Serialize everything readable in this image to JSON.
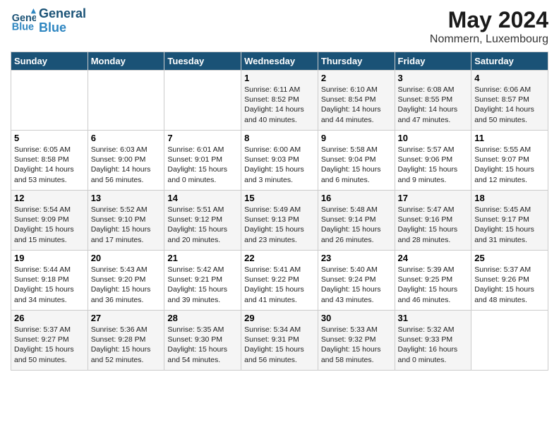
{
  "header": {
    "logo_general": "General",
    "logo_blue": "Blue",
    "month": "May 2024",
    "location": "Nommern, Luxembourg"
  },
  "weekdays": [
    "Sunday",
    "Monday",
    "Tuesday",
    "Wednesday",
    "Thursday",
    "Friday",
    "Saturday"
  ],
  "weeks": [
    [
      {
        "day": "",
        "info": ""
      },
      {
        "day": "",
        "info": ""
      },
      {
        "day": "",
        "info": ""
      },
      {
        "day": "1",
        "info": "Sunrise: 6:11 AM\nSunset: 8:52 PM\nDaylight: 14 hours\nand 40 minutes."
      },
      {
        "day": "2",
        "info": "Sunrise: 6:10 AM\nSunset: 8:54 PM\nDaylight: 14 hours\nand 44 minutes."
      },
      {
        "day": "3",
        "info": "Sunrise: 6:08 AM\nSunset: 8:55 PM\nDaylight: 14 hours\nand 47 minutes."
      },
      {
        "day": "4",
        "info": "Sunrise: 6:06 AM\nSunset: 8:57 PM\nDaylight: 14 hours\nand 50 minutes."
      }
    ],
    [
      {
        "day": "5",
        "info": "Sunrise: 6:05 AM\nSunset: 8:58 PM\nDaylight: 14 hours\nand 53 minutes."
      },
      {
        "day": "6",
        "info": "Sunrise: 6:03 AM\nSunset: 9:00 PM\nDaylight: 14 hours\nand 56 minutes."
      },
      {
        "day": "7",
        "info": "Sunrise: 6:01 AM\nSunset: 9:01 PM\nDaylight: 15 hours\nand 0 minutes."
      },
      {
        "day": "8",
        "info": "Sunrise: 6:00 AM\nSunset: 9:03 PM\nDaylight: 15 hours\nand 3 minutes."
      },
      {
        "day": "9",
        "info": "Sunrise: 5:58 AM\nSunset: 9:04 PM\nDaylight: 15 hours\nand 6 minutes."
      },
      {
        "day": "10",
        "info": "Sunrise: 5:57 AM\nSunset: 9:06 PM\nDaylight: 15 hours\nand 9 minutes."
      },
      {
        "day": "11",
        "info": "Sunrise: 5:55 AM\nSunset: 9:07 PM\nDaylight: 15 hours\nand 12 minutes."
      }
    ],
    [
      {
        "day": "12",
        "info": "Sunrise: 5:54 AM\nSunset: 9:09 PM\nDaylight: 15 hours\nand 15 minutes."
      },
      {
        "day": "13",
        "info": "Sunrise: 5:52 AM\nSunset: 9:10 PM\nDaylight: 15 hours\nand 17 minutes."
      },
      {
        "day": "14",
        "info": "Sunrise: 5:51 AM\nSunset: 9:12 PM\nDaylight: 15 hours\nand 20 minutes."
      },
      {
        "day": "15",
        "info": "Sunrise: 5:49 AM\nSunset: 9:13 PM\nDaylight: 15 hours\nand 23 minutes."
      },
      {
        "day": "16",
        "info": "Sunrise: 5:48 AM\nSunset: 9:14 PM\nDaylight: 15 hours\nand 26 minutes."
      },
      {
        "day": "17",
        "info": "Sunrise: 5:47 AM\nSunset: 9:16 PM\nDaylight: 15 hours\nand 28 minutes."
      },
      {
        "day": "18",
        "info": "Sunrise: 5:45 AM\nSunset: 9:17 PM\nDaylight: 15 hours\nand 31 minutes."
      }
    ],
    [
      {
        "day": "19",
        "info": "Sunrise: 5:44 AM\nSunset: 9:18 PM\nDaylight: 15 hours\nand 34 minutes."
      },
      {
        "day": "20",
        "info": "Sunrise: 5:43 AM\nSunset: 9:20 PM\nDaylight: 15 hours\nand 36 minutes."
      },
      {
        "day": "21",
        "info": "Sunrise: 5:42 AM\nSunset: 9:21 PM\nDaylight: 15 hours\nand 39 minutes."
      },
      {
        "day": "22",
        "info": "Sunrise: 5:41 AM\nSunset: 9:22 PM\nDaylight: 15 hours\nand 41 minutes."
      },
      {
        "day": "23",
        "info": "Sunrise: 5:40 AM\nSunset: 9:24 PM\nDaylight: 15 hours\nand 43 minutes."
      },
      {
        "day": "24",
        "info": "Sunrise: 5:39 AM\nSunset: 9:25 PM\nDaylight: 15 hours\nand 46 minutes."
      },
      {
        "day": "25",
        "info": "Sunrise: 5:37 AM\nSunset: 9:26 PM\nDaylight: 15 hours\nand 48 minutes."
      }
    ],
    [
      {
        "day": "26",
        "info": "Sunrise: 5:37 AM\nSunset: 9:27 PM\nDaylight: 15 hours\nand 50 minutes."
      },
      {
        "day": "27",
        "info": "Sunrise: 5:36 AM\nSunset: 9:28 PM\nDaylight: 15 hours\nand 52 minutes."
      },
      {
        "day": "28",
        "info": "Sunrise: 5:35 AM\nSunset: 9:30 PM\nDaylight: 15 hours\nand 54 minutes."
      },
      {
        "day": "29",
        "info": "Sunrise: 5:34 AM\nSunset: 9:31 PM\nDaylight: 15 hours\nand 56 minutes."
      },
      {
        "day": "30",
        "info": "Sunrise: 5:33 AM\nSunset: 9:32 PM\nDaylight: 15 hours\nand 58 minutes."
      },
      {
        "day": "31",
        "info": "Sunrise: 5:32 AM\nSunset: 9:33 PM\nDaylight: 16 hours\nand 0 minutes."
      },
      {
        "day": "",
        "info": ""
      }
    ]
  ]
}
